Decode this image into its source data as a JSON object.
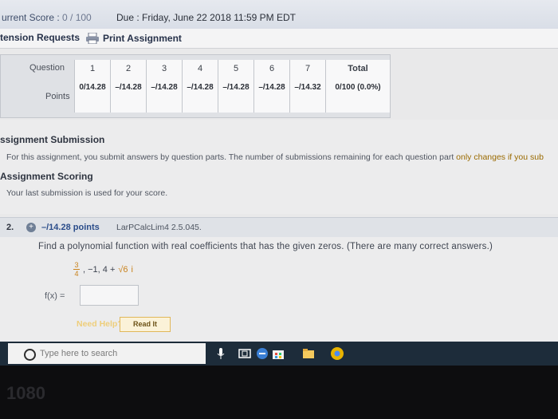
{
  "header": {
    "score_label": "urrent Score : ",
    "score_value": "0 / 100",
    "due": "Due : Friday, June 22 2018 11:59 PM EDT",
    "extension_requests": "tension Requests",
    "print_assignment": "Print Assignment"
  },
  "score_table": {
    "question_label": "Question",
    "points_label": "Points",
    "columns": [
      {
        "q": "1",
        "pts": "0/14.28"
      },
      {
        "q": "2",
        "pts": "–/14.28"
      },
      {
        "q": "3",
        "pts": "–/14.28"
      },
      {
        "q": "4",
        "pts": "–/14.28"
      },
      {
        "q": "5",
        "pts": "–/14.28"
      },
      {
        "q": "6",
        "pts": "–/14.28"
      },
      {
        "q": "7",
        "pts": "–/14.32"
      }
    ],
    "total_label": "Total",
    "total_value": "0/100 (0.0%)"
  },
  "submission": {
    "heading": "ssignment Submission",
    "text": "For this assignment, you submit answers by question parts. The number of submissions remaining for each question part ",
    "text_highlight": "only changes if you sub",
    "scoring_heading": "Assignment Scoring",
    "scoring_text": "Your last submission is used for your score."
  },
  "question": {
    "number": "2.",
    "points": "–/14.28 points",
    "source": "LarPCalcLim4 2.5.045.",
    "prompt": "Find a polynomial function with real coefficients that has the given zeros. (There are many correct answers.)",
    "zero_num": "3",
    "zero_den": "4",
    "zeros_rest": ", −1, 4 + ",
    "sqrt_text": "√6",
    "imag_unit": "i",
    "fx_label": "f(x) =",
    "answer_value": "",
    "need_help": "Need Help?",
    "read_it": "Read It"
  },
  "taskbar": {
    "search_placeholder": "Type here to search"
  },
  "bezel": {
    "brand": "1080"
  }
}
